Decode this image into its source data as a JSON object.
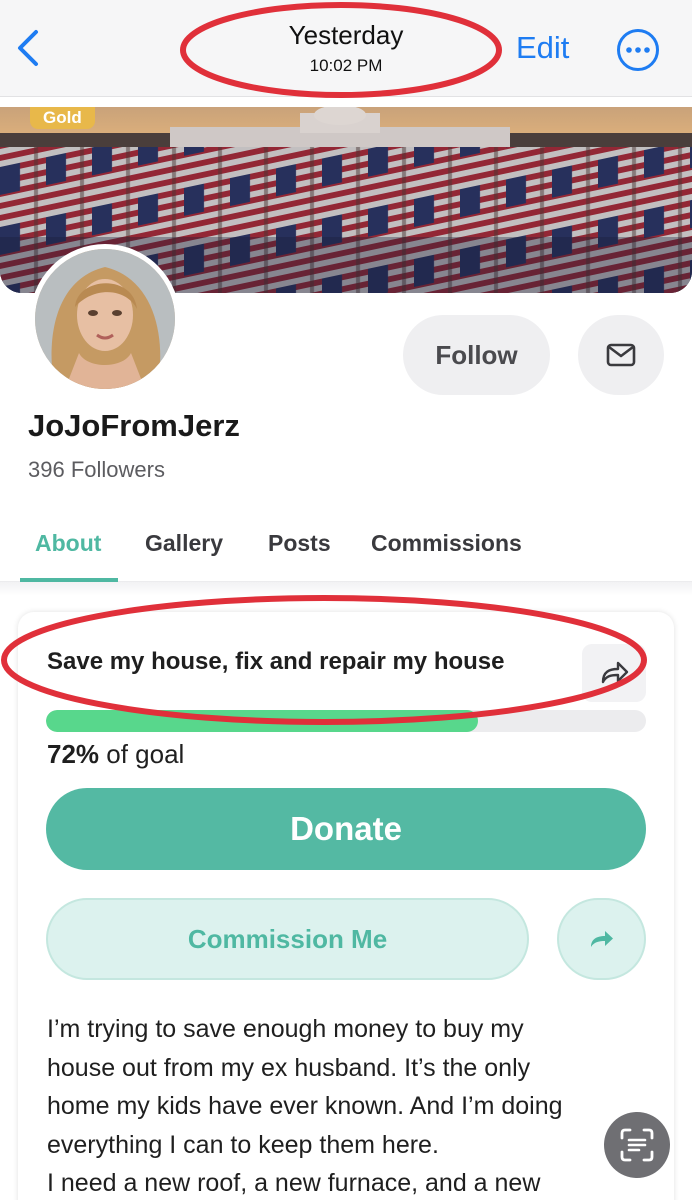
{
  "nav": {
    "title": "Yesterday",
    "subtitle": "10:02 PM",
    "edit_label": "Edit",
    "back_icon": "chevron-left-icon",
    "more_icon": "ellipsis-circle-icon",
    "accent_color": "#1e7cf2"
  },
  "profile": {
    "badge": "Gold",
    "username": "JoJoFromJerz",
    "followers": "396 Followers",
    "follow_label": "Follow",
    "message_icon": "envelope-icon"
  },
  "tabs": [
    {
      "label": "About",
      "active": true
    },
    {
      "label": "Gallery",
      "active": false
    },
    {
      "label": "Posts",
      "active": false
    },
    {
      "label": "Commissions",
      "active": false
    }
  ],
  "fundraiser": {
    "title": "Save my house, fix and repair my house",
    "progress_percent": 72,
    "goal_value": "72%",
    "goal_suffix": " of goal",
    "donate_label": "Donate",
    "commission_label": "Commission Me",
    "share_icon": "share-arrow-icon",
    "bio_lines": [
      "I’m trying to save enough money to buy my",
      "house out from my ex husband. It’s the only",
      "home my kids have ever known. And I’m doing",
      "everything I can to keep them here.",
      "I need a new roof, a new furnace, and a new"
    ]
  },
  "colors": {
    "brand_teal": "#54b9a3",
    "progress_green": "#58d78c",
    "annotation_red": "#e0303a",
    "badge_gold": "#e8b84a"
  },
  "floating": {
    "scan_icon": "scan-text-icon"
  }
}
